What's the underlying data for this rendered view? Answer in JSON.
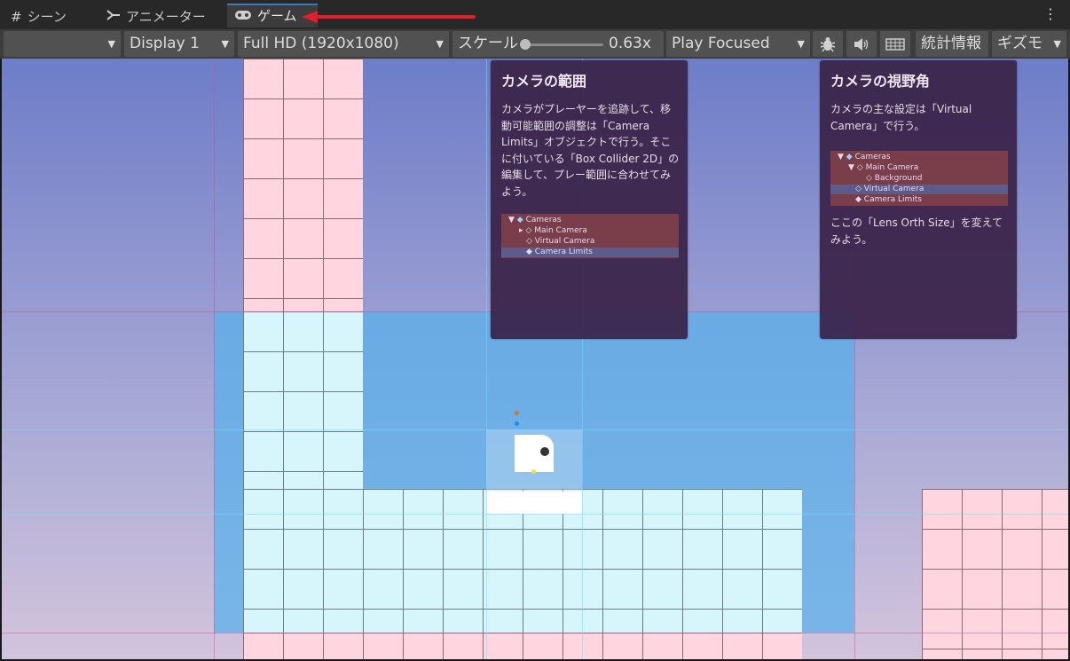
{
  "tabs": [
    {
      "label": "シーン",
      "icon": "grid-icon"
    },
    {
      "label": "アニメーター",
      "icon": "animator-icon"
    },
    {
      "label": "ゲーム",
      "icon": "gamepad-icon",
      "active": true
    }
  ],
  "toolbar": {
    "first_dropdown": "",
    "display": "Display 1",
    "resolution": "Full HD (1920x1080)",
    "scale_label": "スケール",
    "scale_value": "0.63x",
    "scale_fraction": 0.0,
    "play_mode": "Play Focused",
    "stats": "統計情報",
    "gizmos": "ギズモ"
  },
  "panel_camera_limits": {
    "title": "カメラの範囲",
    "lines": [
      "カメラがプレーヤーを追跡して、移",
      "動可能範囲の調整は「Camera",
      "Limits」オブジェクトで行う。そこ",
      "に付いている「Box Collider 2D」の",
      "編集して、プレー範囲に合わせてみ",
      "よう。"
    ],
    "hierarchy": [
      "Cameras",
      "Main Camera",
      "Virtual Camera",
      "Camera Limits"
    ]
  },
  "panel_camera_fov": {
    "title": "カメラの視野角",
    "lines_top": [
      "カメラの主な設定は「Virtual",
      "Camera」で行う。"
    ],
    "hierarchy": [
      "Cameras",
      "Main Camera",
      "Background",
      "Virtual Camera",
      "Camera Limits"
    ],
    "lines_bottom": [
      "ここの「Lens Orth Size」を変えて",
      "みよう。"
    ]
  },
  "colors": {
    "accent": "#3a79bb",
    "arrow": "#e0202a",
    "sky_top": "#6d7dc8",
    "tile_pink": "#ffd6e0",
    "tile_cyan": "#d6f6fb",
    "camera_zone": "#58b0ec"
  }
}
